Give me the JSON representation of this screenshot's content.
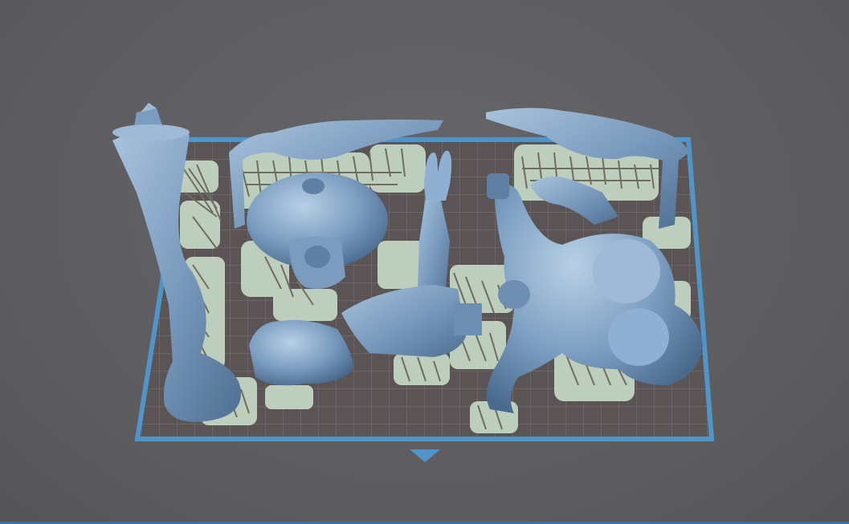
{
  "viewport": {
    "background": "#5f5f61",
    "plate_border_color": "#4f95c9",
    "plate_fill": "#5b5656",
    "grid_color": "#7a7072",
    "model_color": "#7b9cbf",
    "support_color": "#6f6d5e",
    "support_pad_color": "#c9dcc9"
  },
  "icons": {
    "front_marker": "front-indicator-triangle"
  }
}
